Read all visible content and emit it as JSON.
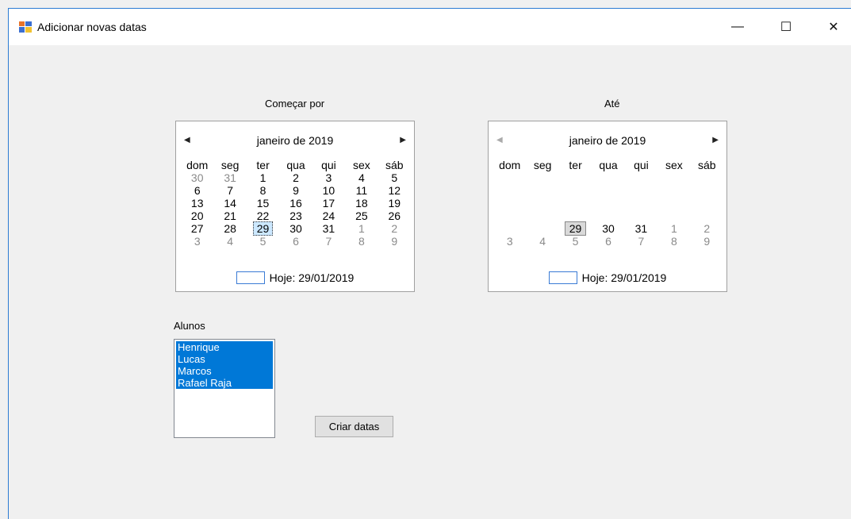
{
  "window": {
    "title": "Adicionar novas datas",
    "controls": {
      "minimize": "—",
      "maximize": "☐",
      "close": "✕"
    }
  },
  "start_calendar": {
    "label": "Começar por",
    "month": "janeiro de 2019",
    "prev": "◀",
    "next": "▶",
    "dows": [
      "dom",
      "seg",
      "ter",
      "qua",
      "qui",
      "sex",
      "sáb"
    ],
    "days": [
      [
        "30",
        "31",
        "1",
        "2",
        "3",
        "4",
        "5"
      ],
      [
        "6",
        "7",
        "8",
        "9",
        "10",
        "11",
        "12"
      ],
      [
        "13",
        "14",
        "15",
        "16",
        "17",
        "18",
        "19"
      ],
      [
        "20",
        "21",
        "22",
        "23",
        "24",
        "25",
        "26"
      ],
      [
        "27",
        "28",
        "29",
        "30",
        "31",
        "1",
        "2"
      ],
      [
        "3",
        "4",
        "5",
        "6",
        "7",
        "8",
        "9"
      ]
    ],
    "selected": "29",
    "today": "Hoje: 29/01/2019"
  },
  "end_calendar": {
    "label": "Até",
    "month": "janeiro de 2019",
    "prev": "◀",
    "next": "▶",
    "dows": [
      "dom",
      "seg",
      "ter",
      "qua",
      "qui",
      "sex",
      "sáb"
    ],
    "days": [
      [
        "29",
        "30",
        "31",
        "1",
        "2"
      ],
      [
        "3",
        "4",
        "5",
        "6",
        "7",
        "8",
        "9"
      ]
    ],
    "selected": "29",
    "today": "Hoje: 29/01/2019"
  },
  "students": {
    "label": "Alunos",
    "items": [
      "Henrique",
      "Lucas",
      "Marcos",
      "Rafael Raja"
    ]
  },
  "actions": {
    "create_label": "Criar datas"
  }
}
